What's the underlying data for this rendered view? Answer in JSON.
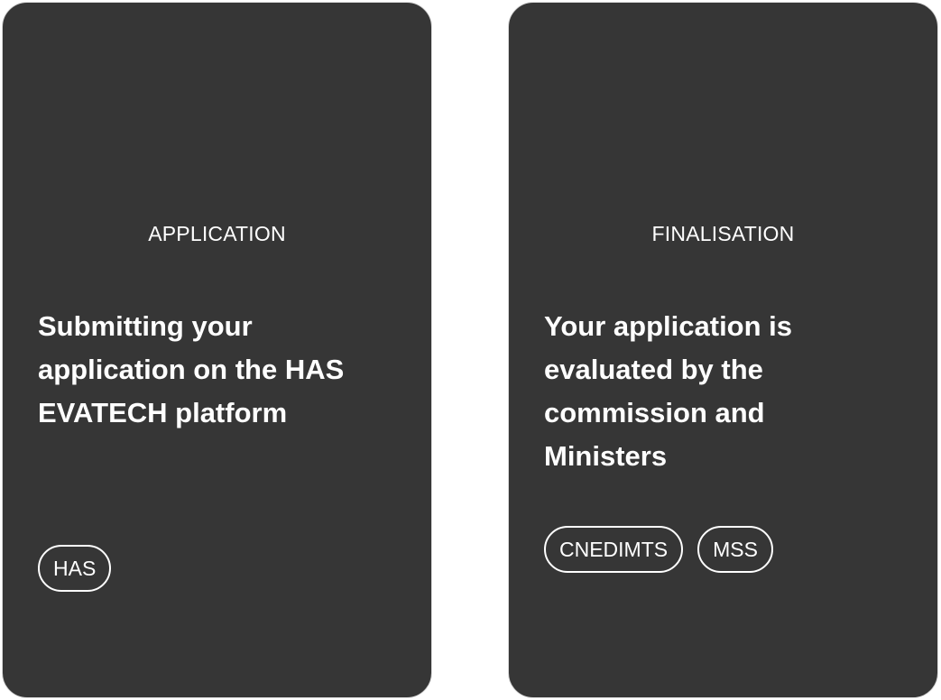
{
  "cards": [
    {
      "step_label": "APPLICATION",
      "title": "Submitting your application on the HAS EVATECH platform",
      "tags": [
        "HAS"
      ]
    },
    {
      "step_label": "FINALISATION",
      "title": "Your application is evaluated by the commission and Ministers",
      "tags": [
        "CNEDIMTS",
        "MSS"
      ]
    }
  ],
  "colors": {
    "card_background": "#363636",
    "card_border": "#d9d9d9",
    "text": "#ffffff"
  }
}
